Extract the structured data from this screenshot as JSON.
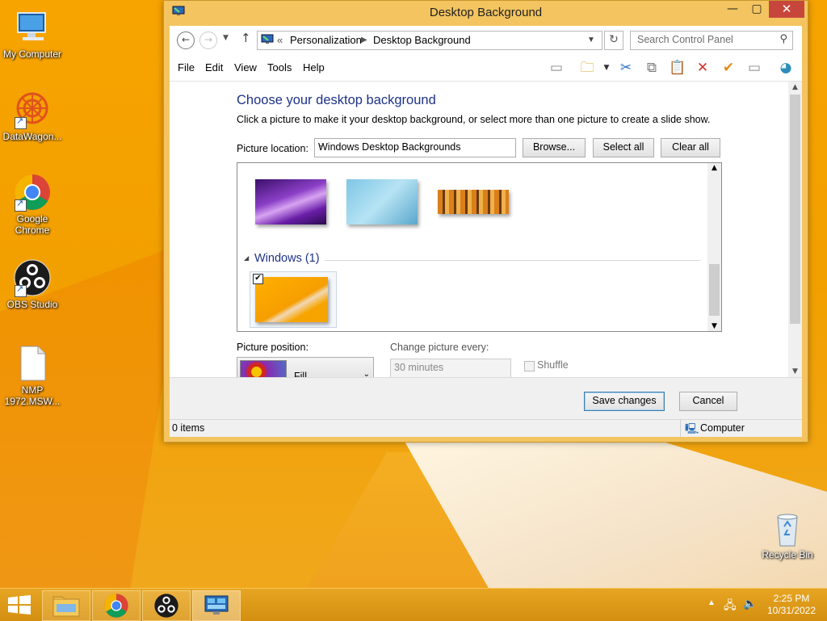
{
  "window": {
    "title": "Desktop Background",
    "breadcrumb_prefix": "«",
    "breadcrumb": [
      "Personalization",
      "Desktop Background"
    ],
    "search_placeholder": "Search Control Panel",
    "menus": [
      "File",
      "Edit",
      "View",
      "Tools",
      "Help"
    ]
  },
  "main": {
    "heading": "Choose your desktop background",
    "subtext": "Click a picture to make it your desktop background, or select more than one picture to create a slide show.",
    "picture_location_label": "Picture location:",
    "picture_location_value": "Windows Desktop Backgrounds",
    "browse_label": "Browse...",
    "select_all_label": "Select all",
    "clear_all_label": "Clear all",
    "group_windows": "Windows (1)",
    "picture_position_label": "Picture position:",
    "picture_position_value": "Fill",
    "change_every_label": "Change picture every:",
    "change_every_value": "30 minutes",
    "shuffle_label": "Shuffle"
  },
  "footer": {
    "save_label": "Save changes",
    "cancel_label": "Cancel"
  },
  "status": {
    "items": "0 items",
    "location": "Computer"
  },
  "desktop_icons": [
    {
      "label": "My Computer"
    },
    {
      "label": "DataWagon..."
    },
    {
      "label": "Google Chrome"
    },
    {
      "label": "OBS Studio"
    },
    {
      "label": "NMP 1972.MSW..."
    },
    {
      "label": "Recycle Bin"
    }
  ],
  "clock": {
    "time": "2:25 PM",
    "date": "10/31/2022"
  },
  "colors": {
    "accent_heading": "#1e3287",
    "window_frame": "#f3c45f",
    "close_button": "#c7463c",
    "desktop": "#f7a400"
  }
}
